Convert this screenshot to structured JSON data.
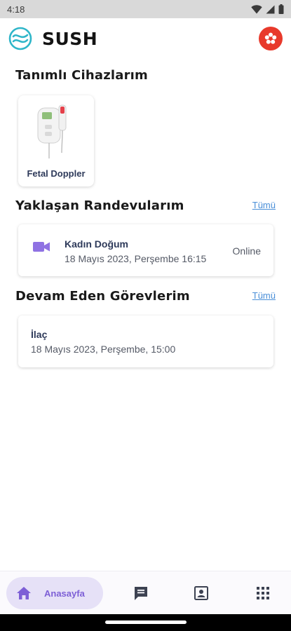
{
  "status_bar": {
    "time": "4:18"
  },
  "app": {
    "title": "SUSH"
  },
  "devices": {
    "title": "Tanımlı Cihazlarım",
    "items": [
      {
        "label": "Fetal Doppler"
      }
    ]
  },
  "appointments": {
    "title": "Yaklaşan Randevularım",
    "see_all": "Tümü",
    "items": [
      {
        "title": "Kadın Doğum",
        "datetime": "18 Mayıs 2023, Perşembe 16:15",
        "status": "Online",
        "icon": "video-icon"
      }
    ]
  },
  "tasks": {
    "title": "Devam Eden Görevlerim",
    "see_all": "Tümü",
    "items": [
      {
        "title": "İlaç",
        "datetime": "18 Mayıs 2023, Perşembe, 15:00"
      }
    ]
  },
  "bottom_nav": {
    "items": [
      {
        "label": "Anasayfa",
        "icon": "home-icon",
        "active": true
      },
      {
        "icon": "chat-icon"
      },
      {
        "icon": "contact-icon"
      },
      {
        "icon": "apps-grid-icon"
      }
    ]
  },
  "colors": {
    "accent": "#7d5fd6",
    "accent_bg": "#e6e1f7",
    "link": "#4a8fd8",
    "notification": "#e8392b",
    "card_text": "#2e3a5a"
  }
}
